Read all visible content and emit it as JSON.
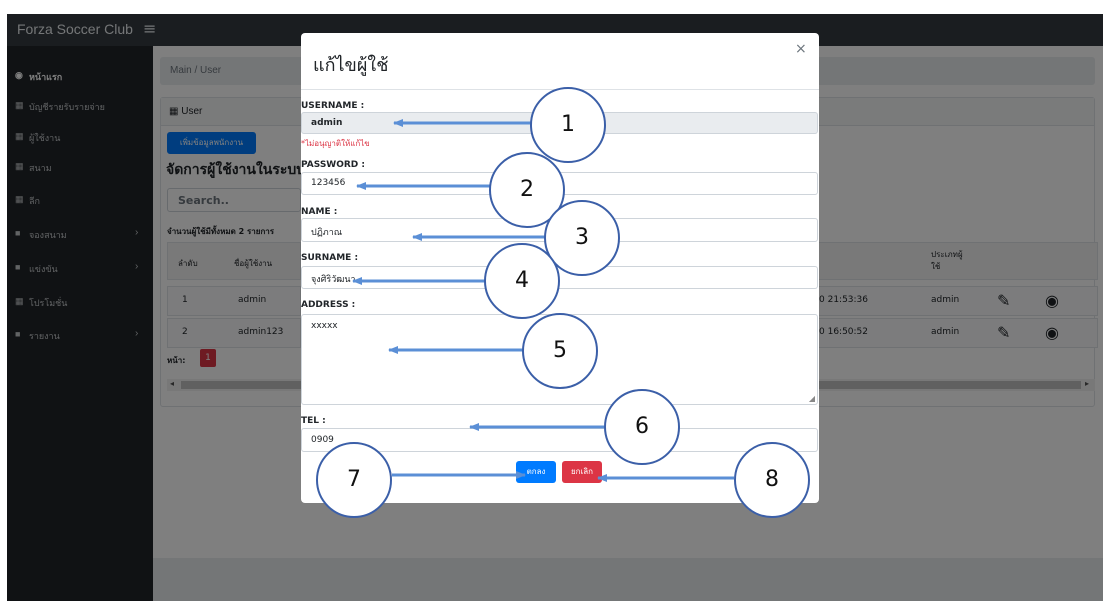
{
  "app": {
    "brand": "Forza Soccer Club",
    "menu_glyph": "≡"
  },
  "sidebar": {
    "items": [
      {
        "icon": "dashboard-icon",
        "glyph": "◉",
        "label": "หน้าแรก",
        "active": true,
        "caret": ""
      },
      {
        "icon": "table-icon",
        "glyph": "▦",
        "label": "บัญชีรายรับรายจ่าย",
        "active": false,
        "caret": ""
      },
      {
        "icon": "table-icon",
        "glyph": "▦",
        "label": "ผู้ใช้งาน",
        "active": false,
        "caret": ""
      },
      {
        "icon": "table-icon",
        "glyph": "▦",
        "label": "สนาม",
        "active": false,
        "caret": ""
      },
      {
        "icon": "table-icon",
        "glyph": "▦",
        "label": "ลีก",
        "active": false,
        "caret": ""
      },
      {
        "icon": "folder-icon",
        "glyph": "■",
        "label": "จองสนาม",
        "active": false,
        "caret": "›"
      },
      {
        "icon": "folder-icon",
        "glyph": "■",
        "label": "แข่งขัน",
        "active": false,
        "caret": "›"
      },
      {
        "icon": "table-icon",
        "glyph": "▦",
        "label": "โปรโมชั่น",
        "active": false,
        "caret": ""
      },
      {
        "icon": "folder-icon",
        "glyph": "■",
        "label": "รายงาน",
        "active": false,
        "caret": "›"
      }
    ]
  },
  "main": {
    "breadcrumb": "Main / User",
    "card_header": "▦ User",
    "add_button": "เพิ่มข้อมูลพนักงาน",
    "title": "จัดการผู้ใช้งานในระบบ",
    "search_placeholder": "Search..",
    "count_text": "จำนวนผู้ใช้มีทั้งหมด 2 รายการ",
    "table": {
      "col_order": "ลำดับ",
      "col_username": "ชื่อผู้ใช้งาน",
      "col_type": "ประเภทผู้ใช้",
      "rows": [
        {
          "order": "1",
          "username": "admin",
          "datetime": "0 21:53:36",
          "type": "admin"
        },
        {
          "order": "2",
          "username": "admin123",
          "datetime": "0 16:50:52",
          "type": "admin"
        }
      ]
    },
    "page_label": "หน้า:",
    "page_current": "1",
    "scroll_left": "◂",
    "scroll_right": "▸"
  },
  "modal": {
    "title": "แก้ไขผู้ใช้",
    "close": "×",
    "fields": {
      "username": {
        "label": "USERNAME :",
        "value": "admin",
        "note": "*ไม่อนุญาติให้แก้ไข"
      },
      "password": {
        "label": "PASSWORD :",
        "value": "123456"
      },
      "name": {
        "label": "NAME :",
        "value": "ปฏิภาณ"
      },
      "surname": {
        "label": "SURNAME :",
        "value": "จุงศิริวัฒนา"
      },
      "address": {
        "label": "ADDRESS :",
        "value": "xxxxx"
      },
      "tel": {
        "label": "TEL :",
        "value": "0909"
      }
    },
    "ok_label": "ตกลง",
    "cancel_label": "ยกเลิก"
  },
  "callouts": [
    "1",
    "2",
    "3",
    "4",
    "5",
    "6",
    "7",
    "8"
  ],
  "colors": {
    "navbar": "#343a40",
    "sidebar": "#212529",
    "primary": "#007bff",
    "danger": "#dc3545",
    "annotation": "#3b5fa8",
    "arrow": "#5b8fd6"
  }
}
